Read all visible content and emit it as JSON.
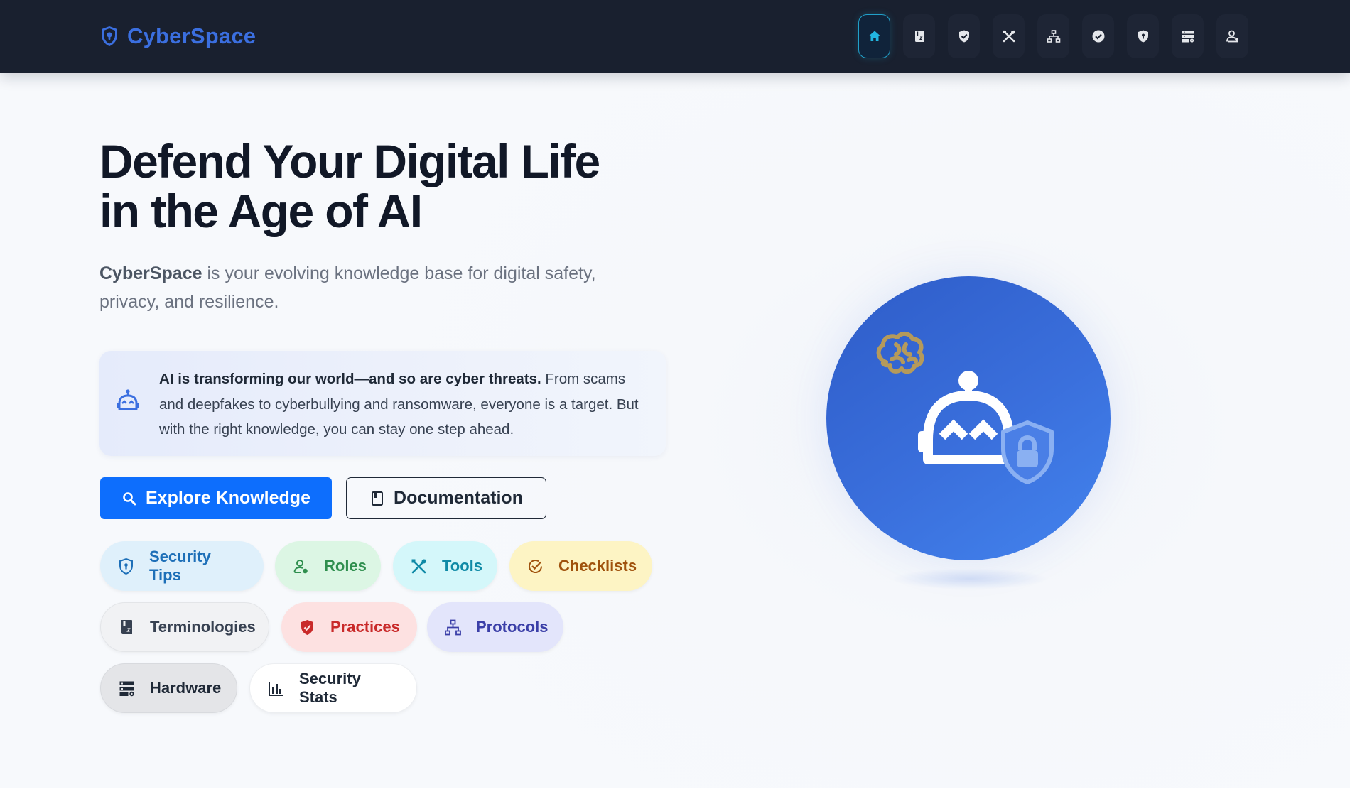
{
  "brand": {
    "name": "CyberSpace"
  },
  "nav": {
    "icons": [
      "home-icon",
      "book-icon",
      "shield-check-icon",
      "tools-icon",
      "network-icon",
      "check-circle-icon",
      "shield-lock-icon",
      "server-icon",
      "user-icon"
    ],
    "active_index": 0
  },
  "hero": {
    "title_line1": "Defend Your Digital Life",
    "title_line2": "in the Age of AI",
    "subtitle_brand": "CyberSpace",
    "subtitle_rest": " is your evolving knowledge base for digital safety, privacy, and resilience."
  },
  "info": {
    "icon": "robot-icon",
    "bold": "AI is transforming our world—and so are cyber threats.",
    "text": " From scams and deepfakes to cyberbullying and ransomware, everyone is a target. But with the right knowledge, you can stay one step ahead."
  },
  "buttons": {
    "explore_label": "Explore Knowledge",
    "docs_label": "Documentation"
  },
  "chips": [
    {
      "label": "Security Tips",
      "icon": "shield-icon",
      "color": "#1d6fb8",
      "bg": "#dff0fb"
    },
    {
      "label": "Roles",
      "icon": "user-gear-icon",
      "color": "#2f8f4e",
      "bg": "#dcf6e4"
    },
    {
      "label": "Tools",
      "icon": "tools-icon",
      "color": "#0f8aa6",
      "bg": "#d4f7fa"
    },
    {
      "label": "Checklists",
      "icon": "check-circle-icon",
      "color": "#a0520d",
      "bg": "#fdf4c4"
    },
    {
      "label": "Terminologies",
      "icon": "book-icon",
      "color": "#374151",
      "bg": "#f1f2f4"
    },
    {
      "label": "Practices",
      "icon": "shield-check-icon",
      "color": "#c92a2a",
      "bg": "#fde1e1"
    },
    {
      "label": "Protocols",
      "icon": "network-icon",
      "color": "#3b3fa8",
      "bg": "#e3e5fb"
    },
    {
      "label": "Hardware",
      "icon": "server-icon",
      "color": "#1f2937",
      "bg": "#e4e5e8"
    },
    {
      "label": "Security Stats",
      "icon": "bar-chart-icon",
      "color": "#1f2937",
      "bg": "#ffffff"
    }
  ],
  "colors": {
    "navbar": "#19202f",
    "brand": "#3b6fe0",
    "primary": "#0d6efd",
    "accent_cyan": "#21a0c9"
  }
}
